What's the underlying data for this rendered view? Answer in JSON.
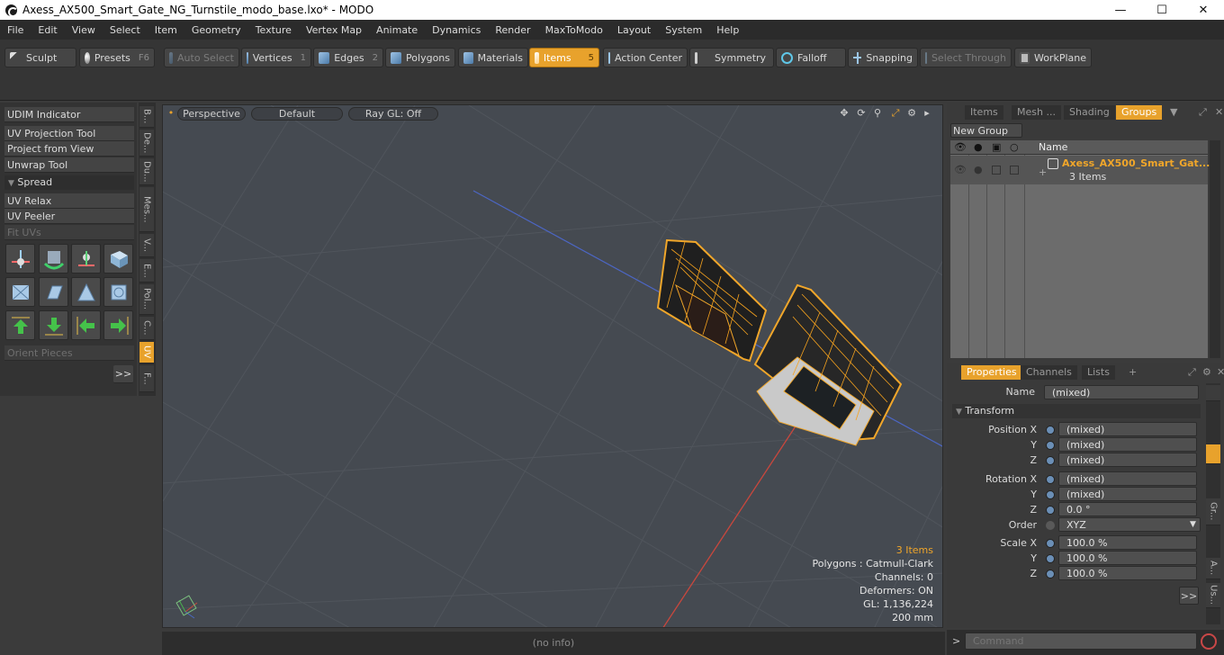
{
  "window": {
    "title": "Axess_AX500_Smart_Gate_NG_Turnstile_modo_base.lxo* - MODO"
  },
  "menu": [
    "File",
    "Edit",
    "View",
    "Select",
    "Item",
    "Geometry",
    "Texture",
    "Vertex Map",
    "Animate",
    "Dynamics",
    "Render",
    "MaxToModo",
    "Layout",
    "System",
    "Help"
  ],
  "toolbar": {
    "sculpt": "Sculpt",
    "presets": "Presets",
    "presets_key": "F6",
    "auto_select": "Auto Select",
    "vertices": "Vertices",
    "vertices_key": "1",
    "edges": "Edges",
    "edges_key": "2",
    "polygons": "Polygons",
    "materials": "Materials",
    "items": "Items",
    "items_key": "5",
    "action_center": "Action Center",
    "symmetry": "Symmetry",
    "falloff": "Falloff",
    "snapping": "Snapping",
    "select_through": "Select Through",
    "workplane": "WorkPlane"
  },
  "left_tools": {
    "udim": "UDIM Indicator",
    "uv_projection": "UV Projection Tool",
    "project_from_view": "Project from View",
    "unwrap": "Unwrap Tool",
    "spread": "Spread",
    "uv_relax": "UV Relax",
    "uv_peeler": "UV Peeler",
    "fit_uvs": "Fit UVs",
    "orient_pieces": "Orient Pieces",
    "more": ">>"
  },
  "vertical_tabs": [
    "B...",
    "De...",
    "Du...",
    "Mes...",
    "V...",
    "E...",
    "Pol...",
    "C...",
    "UV",
    "F..."
  ],
  "viewport": {
    "view": "Perspective",
    "shading": "Default",
    "raygl": "Ray GL: Off",
    "info": {
      "items": "3 Items",
      "polygons": "Polygons : Catmull-Clark",
      "channels": "Channels: 0",
      "deformers": "Deformers: ON",
      "gl": "GL: 1,136,224",
      "scale": "200 mm"
    }
  },
  "groups_panel": {
    "tabs": [
      "Items",
      "Mesh ...",
      "Shading",
      "Groups"
    ],
    "active_tab": "Groups",
    "new_group": "New Group",
    "col_name": "Name",
    "group_name": "Axess_AX500_Smart_Gat...",
    "group_count": "3 Items"
  },
  "properties": {
    "tabs": [
      "Properties",
      "Channels",
      "Lists"
    ],
    "add_tab": "+",
    "name_label": "Name",
    "name_value": "(mixed)",
    "transform": "Transform",
    "position_label": "Position X",
    "position": [
      "(mixed)",
      "(mixed)",
      "(mixed)"
    ],
    "rotation_label": "Rotation X",
    "rotation": [
      "(mixed)",
      "(mixed)",
      "0.0 °"
    ],
    "order_label": "Order",
    "order_value": "XYZ",
    "scale_label": "Scale X",
    "scale": [
      "100.0 %",
      "100.0 %",
      "100.0 %"
    ],
    "y": "Y",
    "z": "Z",
    "more": ">>",
    "side_tabs": [
      "Gr...",
      "A...",
      "Us..."
    ]
  },
  "status": {
    "info": "(no info)"
  },
  "command": {
    "prompt": ">",
    "placeholder": "Command"
  },
  "colors": {
    "accent": "#e8a22c",
    "viewport_bg": "#454a51",
    "panel": "#3a3a3a"
  }
}
